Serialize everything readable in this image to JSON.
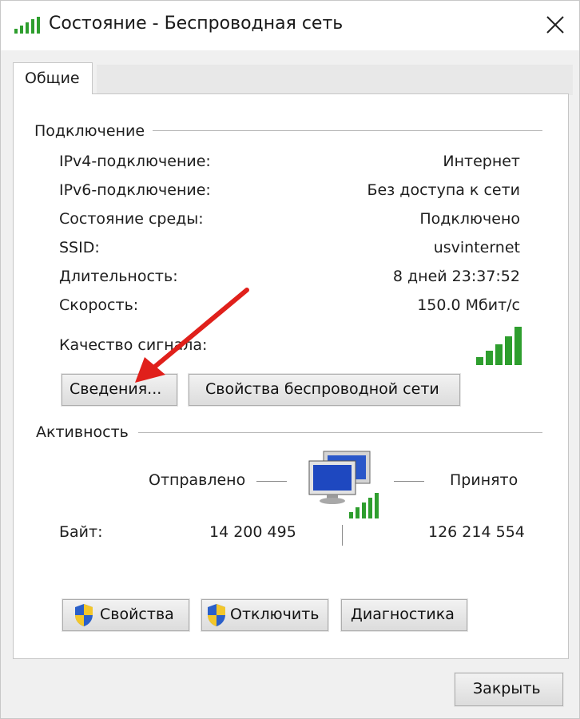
{
  "window": {
    "title": "Состояние - Беспроводная сеть",
    "icons": {
      "title": "wifi-signal-icon",
      "close": "close-icon"
    }
  },
  "tabs": [
    {
      "label": "Общие",
      "selected": true
    }
  ],
  "connection": {
    "group_title": "Подключение",
    "rows": [
      {
        "label": "IPv4-подключение:",
        "value": "Интернет"
      },
      {
        "label": "IPv6-подключение:",
        "value": "Без доступа к сети"
      },
      {
        "label": "Состояние среды:",
        "value": "Подключено"
      },
      {
        "label": "SSID:",
        "value": "usvinternet"
      },
      {
        "label": "Длительность:",
        "value": "8 дней 23:37:52"
      },
      {
        "label": "Скорость:",
        "value": "150.0 Мбит/с"
      }
    ],
    "signal_label": "Качество сигнала:",
    "signal_bars_lit": 5,
    "signal_bars_total": 5,
    "details_button": "Сведения...",
    "wireless_props_button": "Свойства беспроводной сети"
  },
  "activity": {
    "group_title": "Активность",
    "sent_label": "Отправлено",
    "received_label": "Принято",
    "bytes_label": "Байт:",
    "bytes_sent": "14 200 495",
    "bytes_received": "126 214 554"
  },
  "actions": {
    "properties": "Свойства",
    "disconnect": "Отключить",
    "diagnose": "Диагностика"
  },
  "footer": {
    "close_button": "Закрыть"
  },
  "colors": {
    "signal_green": "#2e9e2e",
    "arrow_red": "#e0201b",
    "monitor_blue": "#2a57c9"
  }
}
